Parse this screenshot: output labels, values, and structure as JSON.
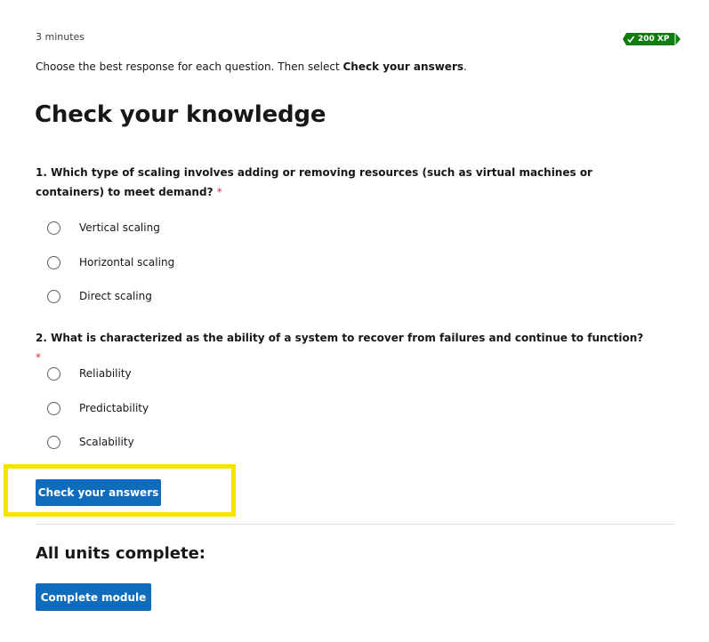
{
  "header": {
    "duration": "3 minutes",
    "xp": "200 XP"
  },
  "instructions": {
    "prefix": "Choose the best response for each question. Then select ",
    "emphasis": "Check your answers",
    "suffix": "."
  },
  "title": "Check your knowledge",
  "questions": [
    {
      "text": "1. Which type of scaling involves adding or removing resources (such as virtual machines or containers) to meet demand?",
      "required_marker": "*",
      "options": [
        "Vertical scaling",
        "Horizontal scaling",
        "Direct scaling"
      ]
    },
    {
      "text": "2. What is characterized as the ability of a system to recover from failures and continue to function?",
      "required_marker": "*",
      "options": [
        "Reliability",
        "Predictability",
        "Scalability"
      ]
    }
  ],
  "check_button": "Check your answers",
  "completion": {
    "title": "All units complete:",
    "button": "Complete module"
  },
  "colors": {
    "accent": "#0f6cbd",
    "xp_badge": "#107c10",
    "highlight": "#f5e400",
    "required": "#d13438"
  }
}
